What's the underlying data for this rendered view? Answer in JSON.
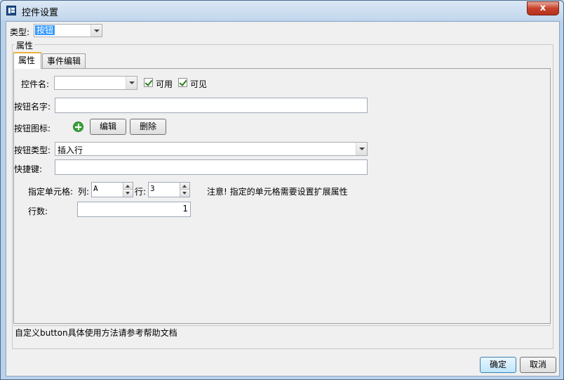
{
  "window": {
    "title": "控件设置",
    "close_label": "x"
  },
  "type_row": {
    "label": "类型:",
    "value": "按钮"
  },
  "group": {
    "title": "属性"
  },
  "tabs": [
    {
      "label": "属性",
      "active": true
    },
    {
      "label": "事件编辑",
      "active": false
    }
  ],
  "form": {
    "control_name_label": "控件名:",
    "control_name_value": "",
    "enabled_label": "可用",
    "enabled_checked": true,
    "visible_label": "可见",
    "visible_checked": true,
    "button_name_label": "按钮名字:",
    "button_name_value": "",
    "button_icon_label": "按钮图标:",
    "edit_label": "编辑",
    "delete_label": "删除",
    "button_type_label": "按钮类型:",
    "button_type_value": "插入行",
    "shortcut_label": "快捷键:",
    "shortcut_value": "",
    "cell_label": "指定单元格:",
    "col_label": "列:",
    "col_value": "A",
    "row_label": "行:",
    "row_value": "3",
    "note": "注意! 指定的单元格需要设置扩展属性",
    "row_count_label": "行数:",
    "row_count_value": "1"
  },
  "help_text": "自定义button具体使用方法请参考帮助文档",
  "footer": {
    "ok_label": "确定",
    "cancel_label": "取消"
  }
}
